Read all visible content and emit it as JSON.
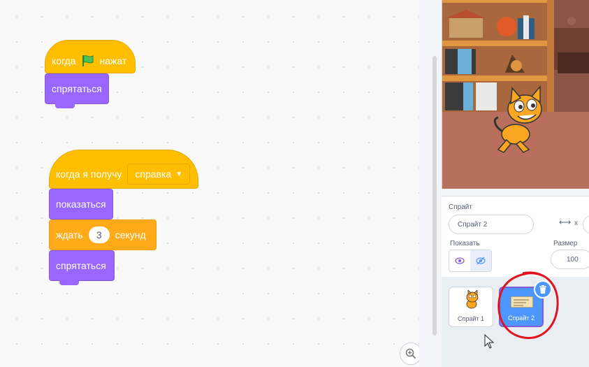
{
  "script1": {
    "hat": {
      "before_flag": "когда",
      "after_flag": "нажат"
    },
    "hide": "спрятаться"
  },
  "script2": {
    "hat": {
      "label": "когда я получу",
      "message": "справка"
    },
    "show": "показаться",
    "wait": {
      "label": "ждать",
      "value": "3",
      "unit": "секунд"
    },
    "hide": "спрятаться"
  },
  "sprite_info": {
    "sprite_label": "Спрайт",
    "sprite_name": "Спрайт 2",
    "x_label": "x",
    "show_label": "Показать",
    "size_label": "Размер",
    "size_value": "100"
  },
  "sprites": [
    {
      "name": "Спрайт 1",
      "selected": false
    },
    {
      "name": "Спрайт 2",
      "selected": true
    }
  ],
  "colors": {
    "event": "#ffbf00",
    "looks": "#9966ff",
    "control": "#ffab19",
    "selection": "#4c97ff",
    "annotation": "#e0141e"
  }
}
